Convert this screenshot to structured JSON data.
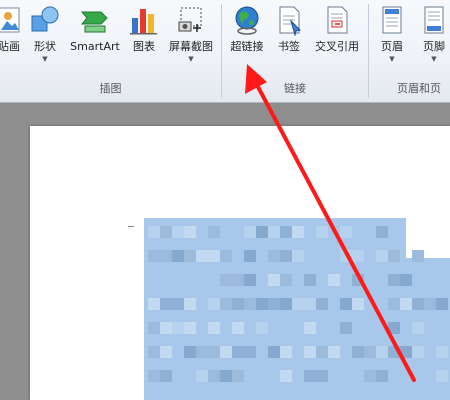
{
  "ribbon": {
    "buttons": {
      "clipart": "贴画",
      "shapes": "形状",
      "smartart": "SmartArt",
      "chart": "图表",
      "screenshot": "屏幕截图",
      "hyperlink": "超链接",
      "bookmark": "书签",
      "crossref": "交叉引用",
      "header": "页眉",
      "footer": "页脚"
    },
    "groups": {
      "illustrations": "插图",
      "links": "链接",
      "header_footer": "页眉和页"
    }
  },
  "colors": {
    "arrow": "#ff1a1a",
    "highlight": "#a7c8ea"
  }
}
